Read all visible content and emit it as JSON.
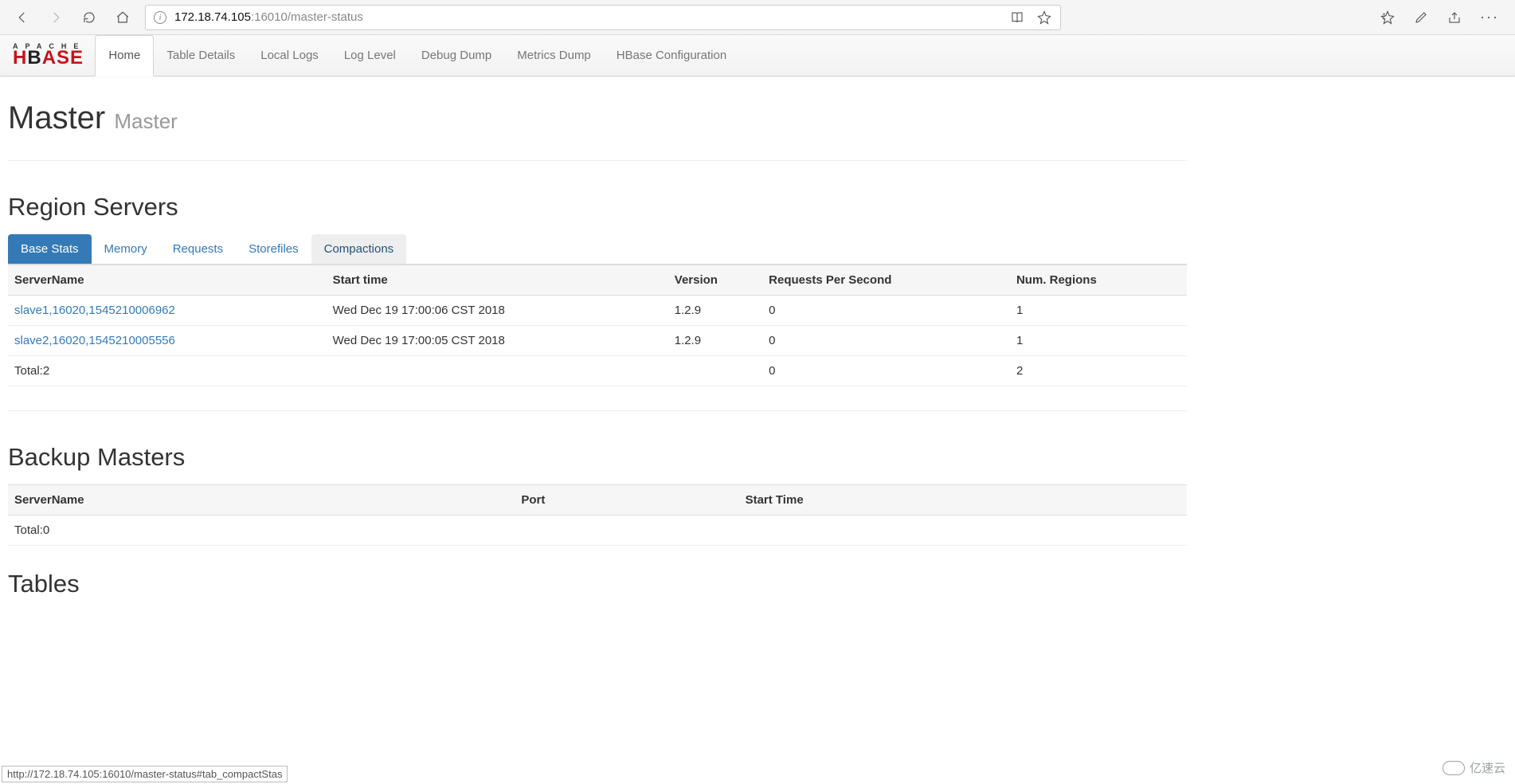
{
  "browser": {
    "address_host": "172.18.74.105",
    "address_path": ":16010/master-status",
    "hover_url": "http://172.18.74.105:16010/master-status#tab_compactStas"
  },
  "nav": {
    "logo_top": "APACHE",
    "items": [
      "Home",
      "Table Details",
      "Local Logs",
      "Log Level",
      "Debug Dump",
      "Metrics Dump",
      "HBase Configuration"
    ],
    "active_index": 0
  },
  "page_header": {
    "title": "Master",
    "subtitle": "Master"
  },
  "region_servers": {
    "title": "Region Servers",
    "tabs": [
      "Base Stats",
      "Memory",
      "Requests",
      "Storefiles",
      "Compactions"
    ],
    "active_tab": 0,
    "hover_tab": 4,
    "columns": [
      "ServerName",
      "Start time",
      "Version",
      "Requests Per Second",
      "Num. Regions"
    ],
    "rows": [
      {
        "server": "slave1,16020,1545210006962",
        "start": "Wed Dec 19 17:00:06 CST 2018",
        "version": "1.2.9",
        "rps": "0",
        "regions": "1"
      },
      {
        "server": "slave2,16020,1545210005556",
        "start": "Wed Dec 19 17:00:05 CST 2018",
        "version": "1.2.9",
        "rps": "0",
        "regions": "1"
      }
    ],
    "total_row": {
      "label": "Total:2",
      "rps": "0",
      "regions": "2"
    }
  },
  "backup_masters": {
    "title": "Backup Masters",
    "columns": [
      "ServerName",
      "Port",
      "Start Time"
    ],
    "total_label": "Total:0"
  },
  "tables": {
    "title": "Tables"
  },
  "watermark": "亿速云"
}
